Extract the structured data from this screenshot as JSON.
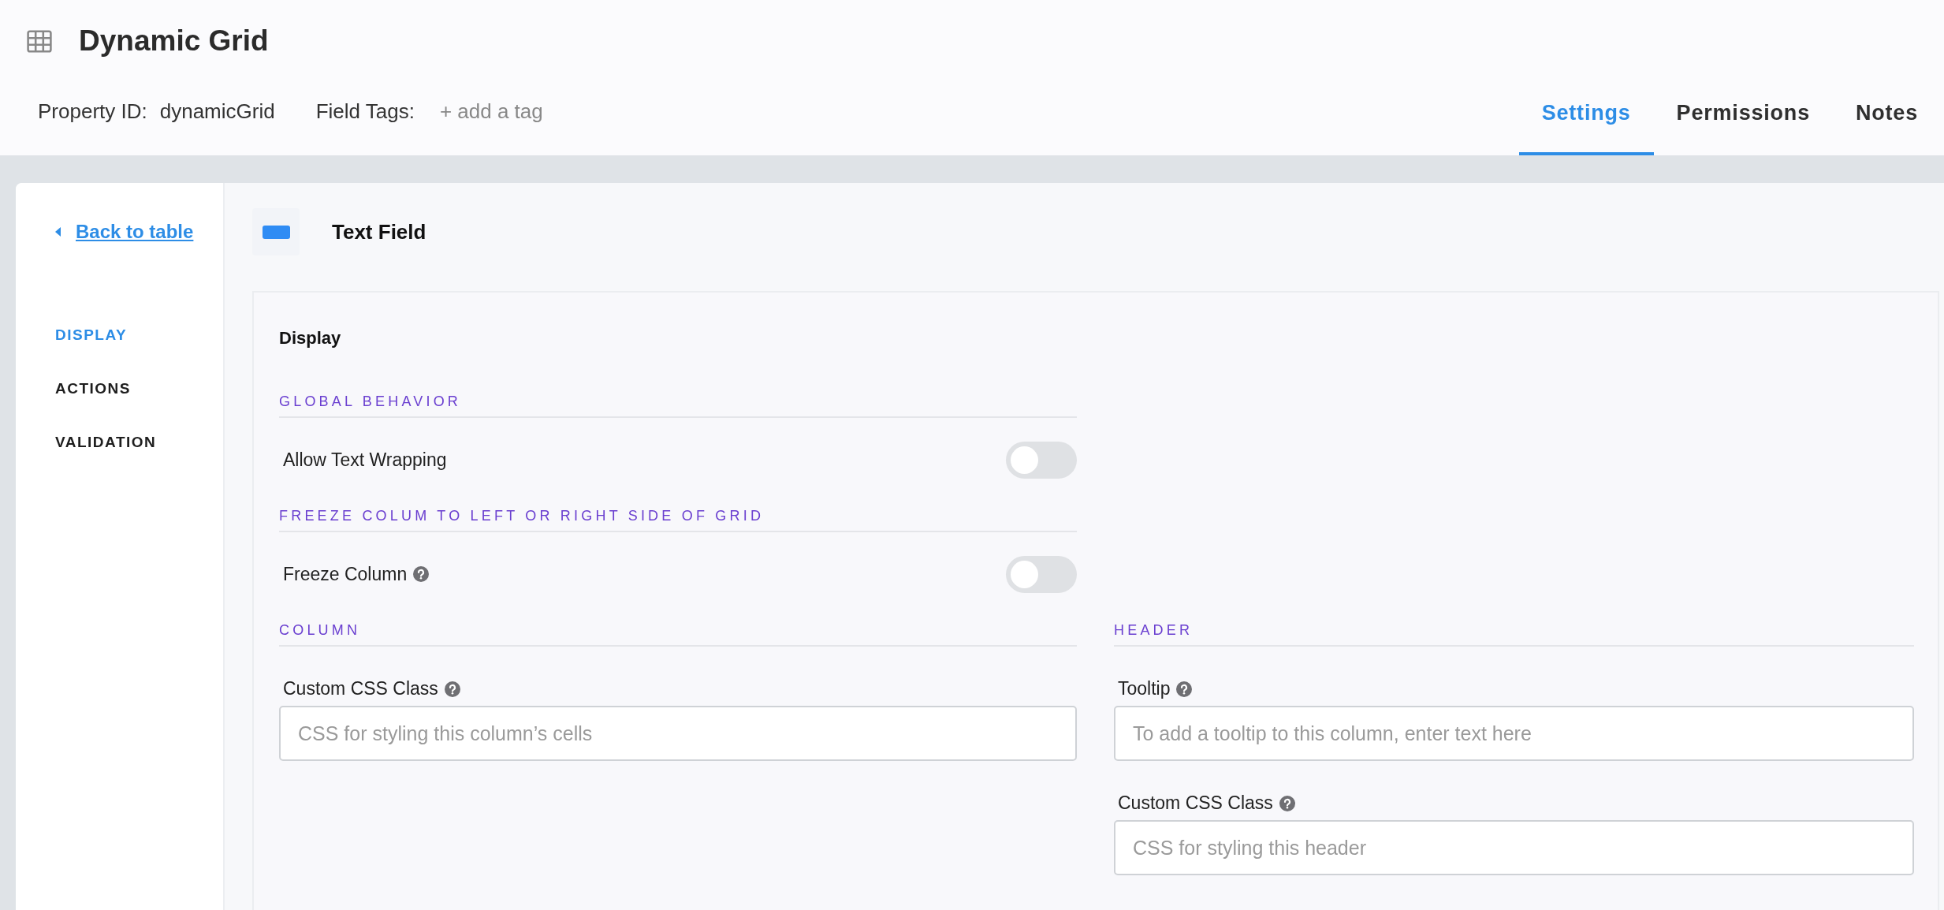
{
  "header": {
    "title": "Dynamic Grid",
    "property_id_label": "Property ID:",
    "property_id": "dynamicGrid",
    "field_tags_label": "Field Tags:",
    "add_tag": "+ add a tag"
  },
  "tabs": [
    {
      "label": "Settings",
      "selected": true
    },
    {
      "label": "Permissions",
      "selected": false
    },
    {
      "label": "Notes",
      "selected": false
    }
  ],
  "sidebar": {
    "back_link": "Back to table",
    "items": [
      {
        "label": "DISPLAY",
        "selected": true
      },
      {
        "label": "ACTIONS",
        "selected": false
      },
      {
        "label": "VALIDATION",
        "selected": false
      }
    ]
  },
  "field_type": {
    "title": "Text Field"
  },
  "panel": {
    "title": "Display",
    "sections": [
      {
        "heading": "GLOBAL BEHAVIOR",
        "rows": [
          {
            "kind": "toggle",
            "label": "Allow Text Wrapping",
            "help": false,
            "on": false
          }
        ]
      },
      {
        "heading": "FREEZE COLUM TO LEFT OR RIGHT SIDE OF GRID",
        "rows": [
          {
            "kind": "toggle",
            "label": "Freeze Column",
            "help": true,
            "on": false
          }
        ]
      }
    ],
    "columns": [
      {
        "heading": "COLUMN",
        "rows": [
          {
            "kind": "input",
            "label": "Custom CSS Class",
            "help": true,
            "placeholder": "CSS for styling this column’s cells"
          }
        ]
      },
      {
        "heading": "HEADER",
        "rows": [
          {
            "kind": "input",
            "label": "Tooltip",
            "help": true,
            "placeholder": "To add a tooltip to this column, enter text here"
          },
          {
            "kind": "input",
            "label": "Custom CSS Class",
            "help": true,
            "placeholder": "CSS for styling this header"
          }
        ]
      }
    ]
  }
}
